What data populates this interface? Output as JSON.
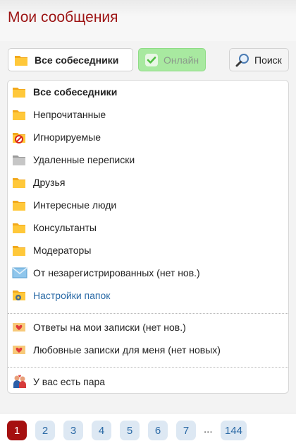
{
  "header": {
    "title": "Мои сообщения"
  },
  "toolbar": {
    "all_label": "Все собеседники",
    "online_label": "Онлайн",
    "search_label": "Поиск"
  },
  "folders": [
    {
      "label": "Все собеседники",
      "icon": "folder-icon"
    },
    {
      "label": "Непрочитанные",
      "icon": "folder-icon"
    },
    {
      "label": "Игнорируемые",
      "icon": "blocked-folder-icon"
    },
    {
      "label": "Удаленные переписки",
      "icon": "gray-folder-icon"
    },
    {
      "label": "Друзья",
      "icon": "folder-icon"
    },
    {
      "label": "Интересные люди",
      "icon": "folder-icon"
    },
    {
      "label": "Консультанты",
      "icon": "folder-icon"
    },
    {
      "label": "Модераторы",
      "icon": "folder-icon"
    },
    {
      "label": "От незарегистрированных (нет нов.)",
      "icon": "envelope-icon"
    },
    {
      "label": "Настройки папок",
      "icon": "folder-settings-icon"
    }
  ],
  "notes": [
    {
      "label": "Ответы на мои записки (нет нов.)",
      "icon": "love-note-icon"
    },
    {
      "label": "Любовные записки для меня (нет новых)",
      "icon": "love-note-icon"
    }
  ],
  "pair": {
    "label": "У вас есть пара",
    "icon": "couple-icon"
  },
  "pagination": {
    "pages": [
      "1",
      "2",
      "3",
      "4",
      "5",
      "6",
      "7"
    ],
    "current": "1",
    "ellipsis": "...",
    "last": "144"
  },
  "colors": {
    "title": "#9c1414",
    "online_button": "#a8e9a0",
    "link": "#2a6aa6",
    "active_page": "#a51010",
    "page_button": "#dde8f3"
  }
}
